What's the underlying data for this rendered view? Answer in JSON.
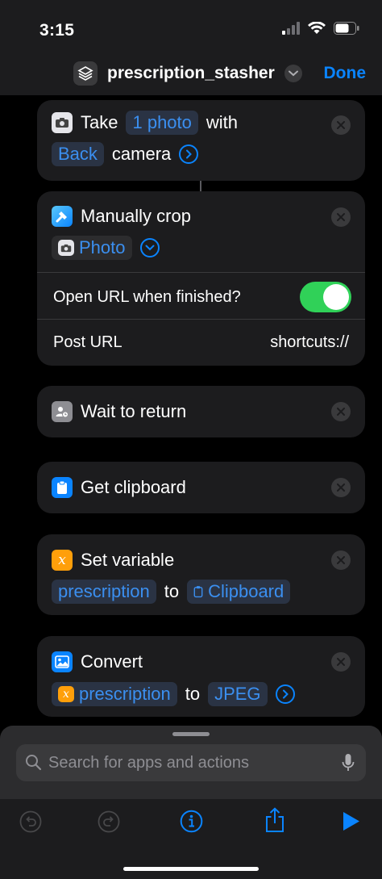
{
  "status": {
    "time": "3:15"
  },
  "nav": {
    "title": "prescription_stasher",
    "done_label": "Done"
  },
  "actions": {
    "take_photo": {
      "take": "Take",
      "count": "1 photo",
      "with": "with",
      "camera_side": "Back",
      "camera": "camera"
    },
    "crop": {
      "title": "Manually crop",
      "input": "Photo",
      "open_url_label": "Open URL when finished?",
      "open_url_enabled": true,
      "post_url_label": "Post URL",
      "post_url_value": "shortcuts://"
    },
    "wait": {
      "title": "Wait to return"
    },
    "clipboard": {
      "title": "Get clipboard"
    },
    "set_variable": {
      "title": "Set variable",
      "var_name": "prescription",
      "to": "to",
      "value": "Clipboard"
    },
    "convert": {
      "title": "Convert",
      "input": "prescription",
      "to": "to",
      "format": "JPEG"
    }
  },
  "search": {
    "placeholder": "Search for apps and actions"
  },
  "colors": {
    "accent": "#0a84ff",
    "toggle_on": "#30d158",
    "variable_orange": "#ff9f0a"
  }
}
